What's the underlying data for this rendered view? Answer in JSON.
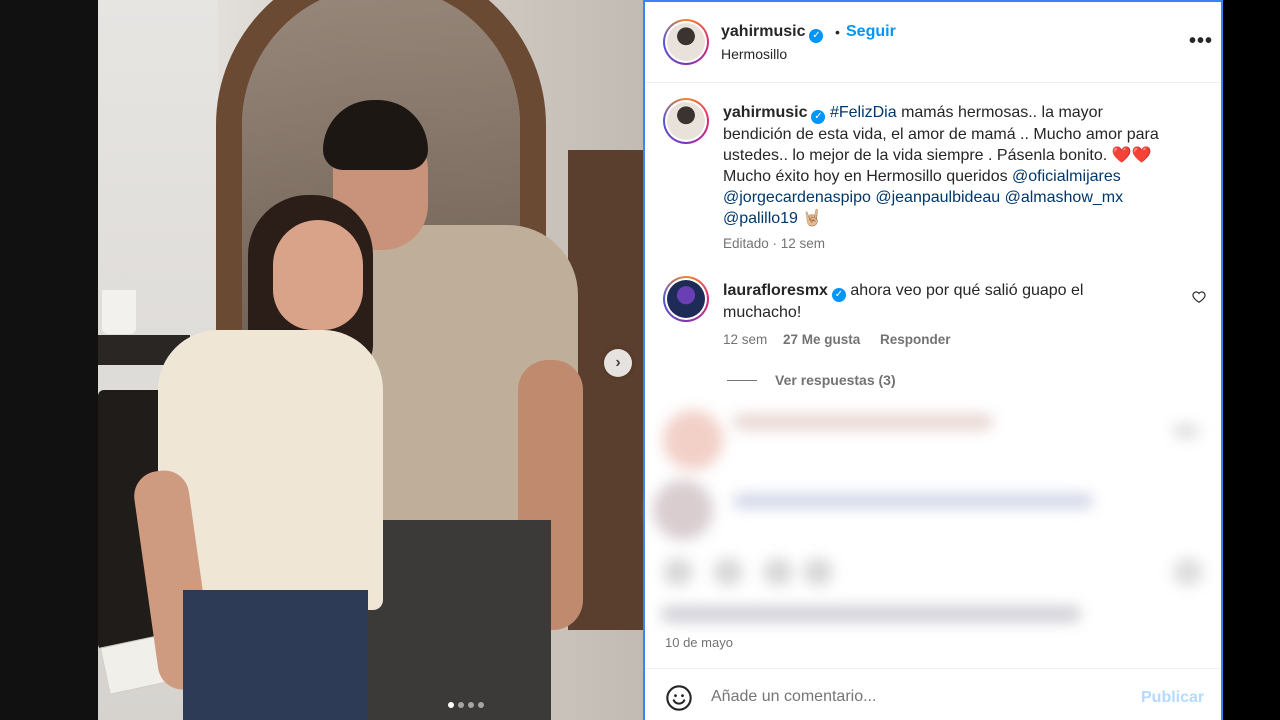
{
  "post": {
    "author": "yahirmusic",
    "follow_label": "Seguir",
    "separator": "•",
    "location": "Hermosillo",
    "more_label": "•••"
  },
  "caption": {
    "author": "yahirmusic",
    "hashtag": "#FelizDia",
    "text1": " mamás hermosas.. la mayor bendición de esta vida, el amor de mamá .. Mucho amor para ustedes.. lo mejor de la vida siempre . Pásenla bonito. ❤️❤️",
    "text2": "Mucho éxito hoy en Hermosillo queridos ",
    "mentions": [
      "@oficialmijares",
      "@jorgecardenaspipo",
      "@jeanpaulbideau",
      "@almashow_mx",
      "@palillo19"
    ],
    "emoji_end": " 🤘🏼",
    "meta": "Editado · 12 sem"
  },
  "comment": {
    "author": "laurafloresmx",
    "text": "ahora veo por qué salió guapo el muchacho!",
    "time": "12 sem",
    "likes": "27 Me gusta",
    "reply_label": "Responder",
    "view_replies": "Ver respuestas (3)"
  },
  "footer": {
    "date": "10 de mayo",
    "comment_placeholder": "Añade un comentario...",
    "publish_label": "Publicar"
  },
  "carousel": {
    "next_icon": "›",
    "dots_total": 4,
    "active_index": 0
  }
}
